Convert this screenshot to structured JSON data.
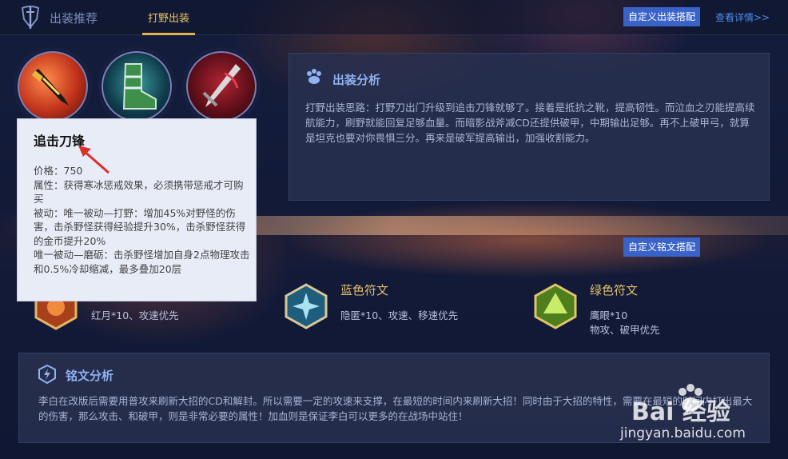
{
  "header": {
    "section_title": "出装推荐",
    "tab_label": "打野出装",
    "custom_equip_button": "自定义出装搭配",
    "detail_link": "查看详情>>"
  },
  "items": [
    {
      "icon": "chasing-blade-icon"
    },
    {
      "icon": "resistance-boots-icon"
    },
    {
      "icon": "bloodweeping-blade-icon"
    }
  ],
  "tooltip": {
    "title": "追击刀锋",
    "lines": [
      "价格：750",
      "属性：获得寒冰惩戒效果，必须携带惩戒才可购买",
      "被动：唯一被动—打野：增加45%对野怪的伤害，击杀野怪获得经验提升30%，击杀野怪获得的金币提升20%",
      "唯一被动—磨砺：击杀野怪增加自身2点物理攻击和0.5%冷却缩减，最多叠加20层"
    ]
  },
  "equip_analysis": {
    "title": "出装分析",
    "text": "打野出装思路：打野刀出门升级到追击刀锋就够了。接着是抵抗之靴，提高韧性。而泣血之刃能提高续航能力，刷野就能回复足够血量。而暗影战斧减CD还提供破甲，中期输出足够。再不上破甲弓，就算是坦克也要对你畏惧三分。再来是破军提高输出，加强收割能力。"
  },
  "runes": {
    "custom_rune_button": "自定义铭文搭配",
    "red": {
      "name": "",
      "desc": "红月*10、攻速优先"
    },
    "blue": {
      "name": "蓝色符文",
      "desc": "隐匿*10、攻速、移速优先"
    },
    "green": {
      "name": "绿色符文",
      "desc_line1": "鹰眼*10",
      "desc_line2": "物攻、破甲优先"
    }
  },
  "rune_analysis": {
    "title": "铭文分析",
    "text": "李白在改版后需要用普攻来刷新大招的CD和解封。所以需要一定的攻速来支撑，在最短的时间内来刷新大招！同时由于大招的特性，需要在最短的时间内打出最大的伤害，那么攻击、和破甲，则是非常必要的属性！加血则是保证李白可以更多的在战场中站住！"
  },
  "watermark": {
    "brand": "Bai  经验",
    "url": "jingyan.baidu.com"
  },
  "colors": {
    "accent_gold": "#e3b24f",
    "button_blue": "#3a63c9",
    "panel_title": "#8fb2f2",
    "annotation_red": "#d9312b"
  }
}
